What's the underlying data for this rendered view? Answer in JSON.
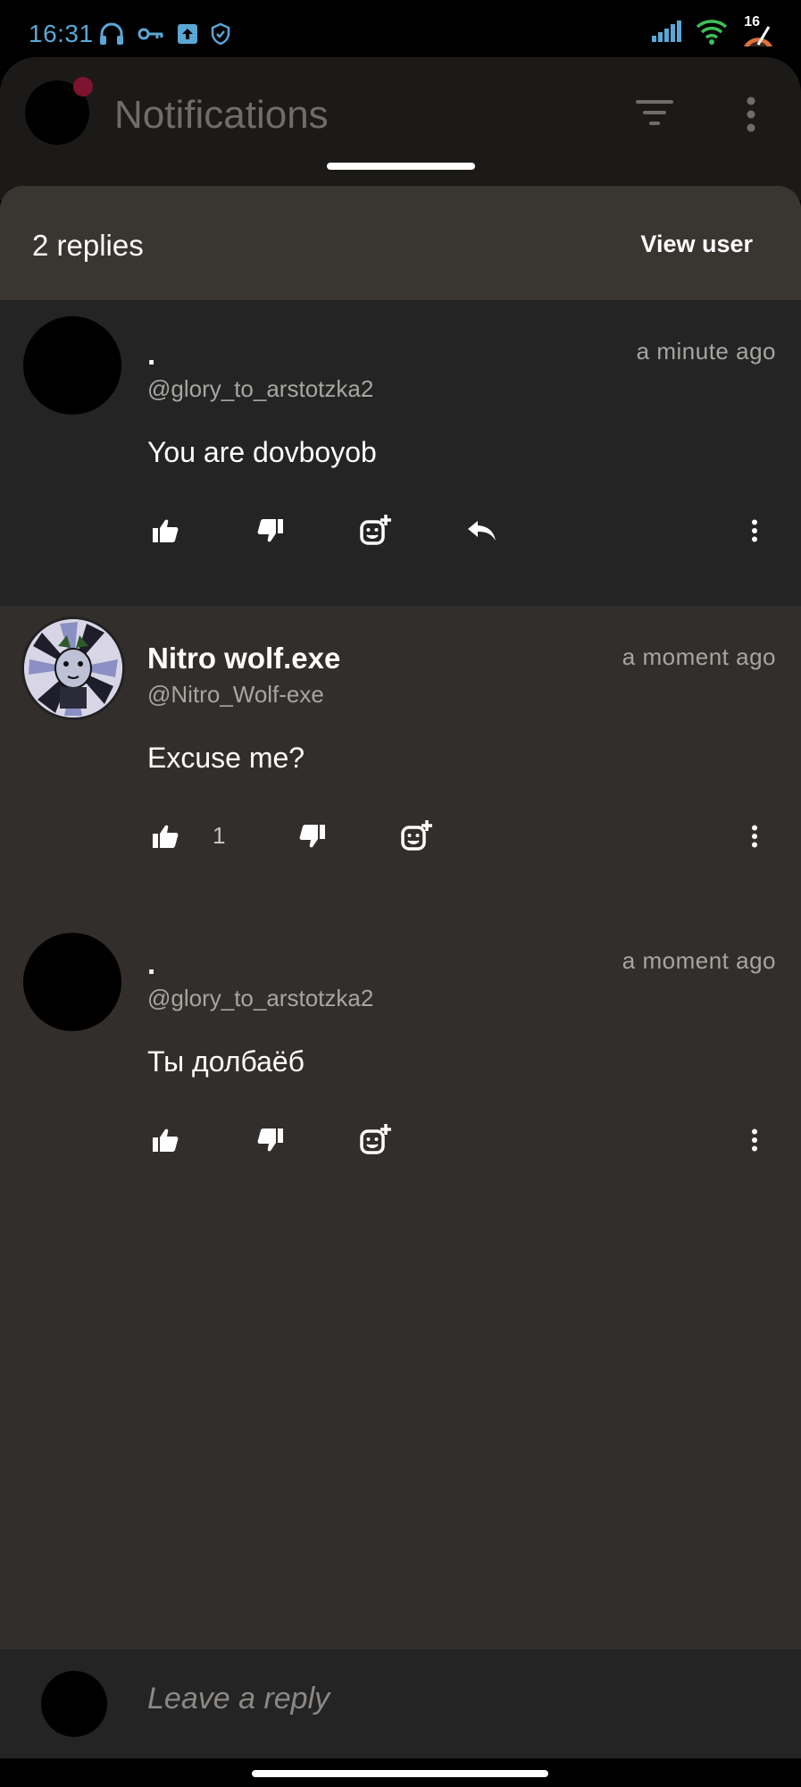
{
  "status_bar": {
    "time": "16:31",
    "battery_level": "16",
    "left_icons": [
      "headphones-icon",
      "key-icon",
      "upload-icon",
      "shield-icon"
    ],
    "right_icons": [
      "signal-icon",
      "wifi-icon",
      "battery-icon"
    ]
  },
  "background_screen": {
    "title": "Notifications"
  },
  "sheet": {
    "title": "2 replies",
    "view_user_label": "View user"
  },
  "comments": [
    {
      "name": ".",
      "handle": "@glory_to_arstotzka2",
      "time": "a minute ago",
      "text": "You are dovboyob",
      "likes": "",
      "has_reply_action": true
    },
    {
      "name": "Nitro wolf.exe",
      "handle": "@Nitro_Wolf-exe",
      "time": "a moment ago",
      "text": "Excuse me?",
      "likes": "1",
      "has_reply_action": false
    },
    {
      "name": ".",
      "handle": "@glory_to_arstotzka2",
      "time": "a moment ago",
      "text": "Ты долбаёб",
      "likes": "",
      "has_reply_action": false
    }
  ],
  "reply_bar": {
    "placeholder": "Leave a reply"
  },
  "colors": {
    "time_blue": "#5aa7d6",
    "sheet_bg": "#322e2b",
    "highlight_bg": "#242424",
    "notification_dot": "#7e1330"
  }
}
